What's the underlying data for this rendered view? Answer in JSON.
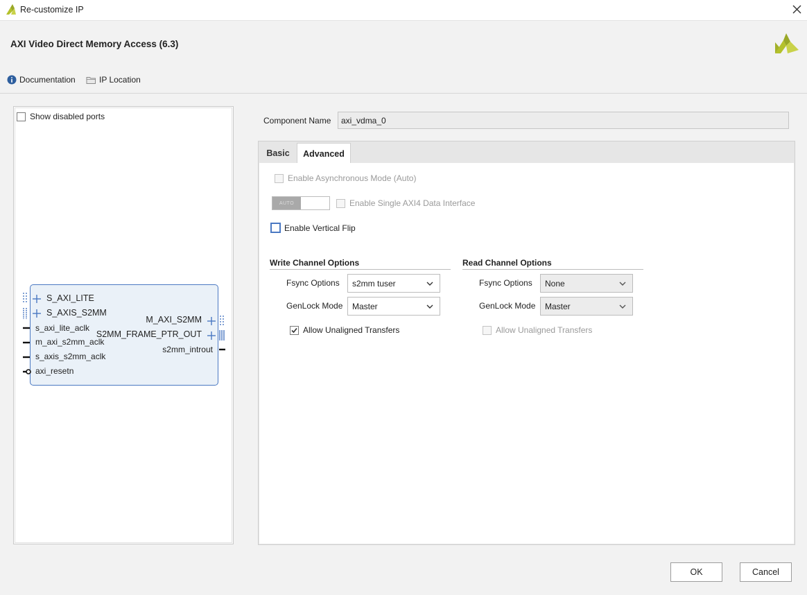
{
  "window": {
    "title": "Re-customize IP",
    "close_icon": "close-icon"
  },
  "header": {
    "ip_title": "AXI Video Direct Memory Access (6.3)",
    "links": {
      "documentation": "Documentation",
      "ip_location": "IP Location"
    }
  },
  "symbol_panel": {
    "show_disabled_ports": {
      "label": "Show disabled ports",
      "checked": false
    },
    "block": {
      "left_ports": [
        "S_AXI_LITE",
        "S_AXIS_S2MM",
        "s_axi_lite_aclk",
        "m_axi_s2mm_aclk",
        "s_axis_s2mm_aclk",
        "axi_resetn"
      ],
      "right_ports": [
        "M_AXI_S2MM",
        "S2MM_FRAME_PTR_OUT",
        "s2mm_introut"
      ]
    }
  },
  "component_name": {
    "label": "Component Name",
    "value": "axi_vdma_0"
  },
  "tabs": {
    "basic": "Basic",
    "advanced": "Advanced",
    "active": "Advanced"
  },
  "advanced": {
    "async_mode": {
      "label": "Enable Asynchronous Mode (Auto)",
      "checked": false,
      "enabled": false
    },
    "toggle": {
      "text": "AUTO"
    },
    "single_axi4": {
      "label": "Enable Single AXI4 Data Interface",
      "checked": false,
      "enabled": false
    },
    "vertical_flip": {
      "label": "Enable Vertical Flip",
      "checked": false
    },
    "write_channel": {
      "title": "Write Channel Options",
      "fsync_label": "Fsync Options",
      "fsync_value": "s2mm tuser",
      "genlock_label": "GenLock Mode",
      "genlock_value": "Master",
      "unaligned_label": "Allow Unaligned Transfers",
      "unaligned_checked": true
    },
    "read_channel": {
      "title": "Read Channel Options",
      "fsync_label": "Fsync Options",
      "fsync_value": "None",
      "genlock_label": "GenLock Mode",
      "genlock_value": "Master",
      "unaligned_label": "Allow Unaligned Transfers",
      "unaligned_checked": false
    }
  },
  "footer": {
    "ok": "OK",
    "cancel": "Cancel"
  },
  "colors": {
    "accent": "#4a78c2",
    "brand": "#b4c12b",
    "block_fill": "#eaf1f8"
  }
}
